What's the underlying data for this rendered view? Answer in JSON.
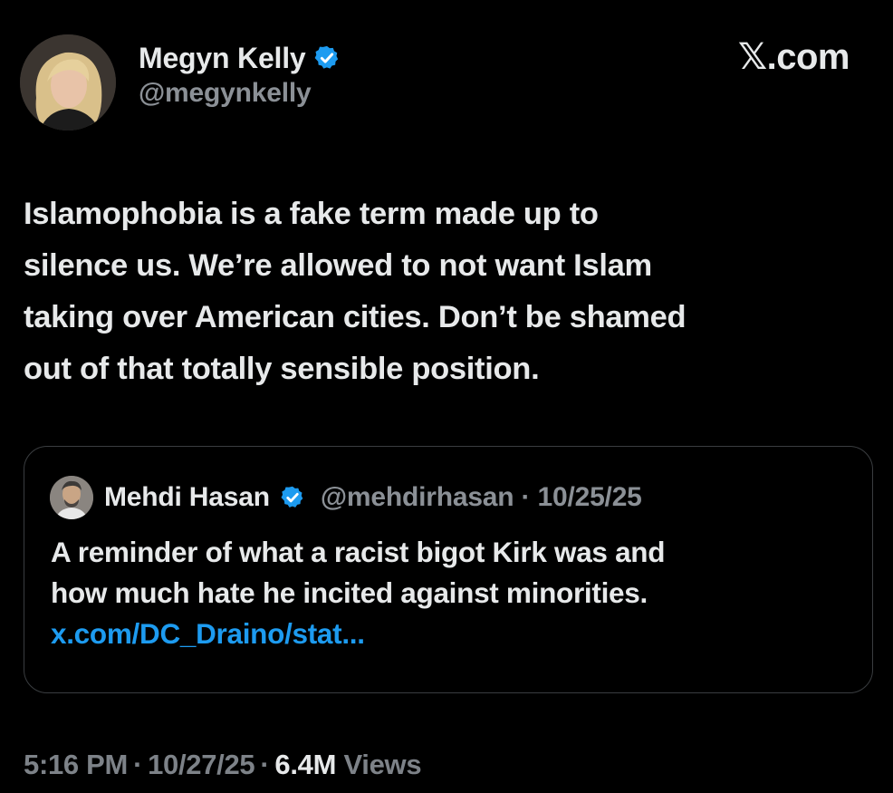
{
  "author": {
    "display_name": "Megyn Kelly",
    "handle": "@megynkelly",
    "verified": true
  },
  "brand": "𝕏.com",
  "tweet": {
    "lines": [
      "Islamophobia is a fake term made up to",
      "silence us. We’re allowed to not want Islam",
      "taking over American cities. Don’t be shamed",
      "out of that totally sensible position."
    ]
  },
  "quoted": {
    "display_name": "Mehdi Hasan",
    "handle_date": "@mehdirhasan · 10/25/25",
    "verified": true,
    "lines": [
      "A reminder of what a racist bigot Kirk was and",
      "how much hate he incited against minorities."
    ],
    "link": "x.com/DC_Draino/stat..."
  },
  "footer": {
    "time": "5:16 PM",
    "date": "10/27/25",
    "views_count": "6.4M",
    "views_label": "Views"
  },
  "colors": {
    "background": "#000000",
    "text": "#e7e9ea",
    "muted": "#8b9096",
    "link": "#1d9bf0",
    "verified": "#1d9bf0",
    "border": "#3a3d40"
  }
}
